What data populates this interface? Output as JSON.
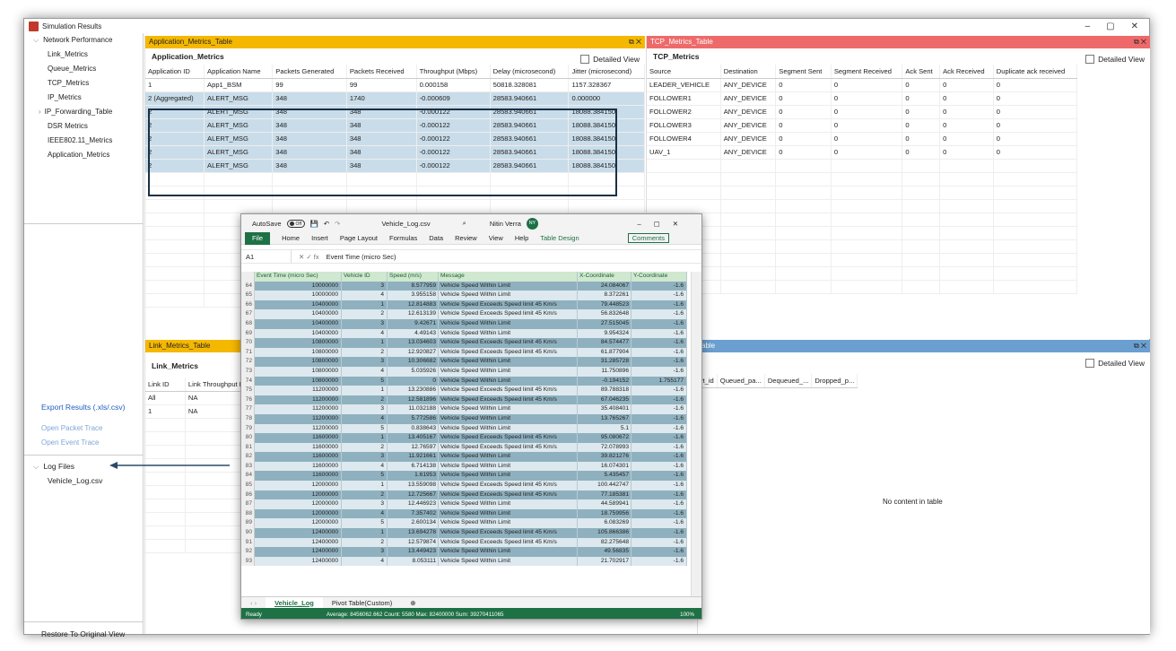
{
  "window": {
    "title": "Simulation Results",
    "controls": [
      "–",
      "▢",
      "✕"
    ]
  },
  "sidebar": {
    "tree_root": "Network Performance",
    "items": [
      "Link_Metrics",
      "Queue_Metrics",
      "TCP_Metrics",
      "IP_Metrics",
      "IP_Forwarding_Table",
      "DSR Metrics",
      "IEEE802.11_Metrics",
      "Application_Metrics"
    ],
    "export": "Export Results (.xls/.csv)",
    "open_packet": "Open Packet Trace",
    "open_event": "Open Event Trace",
    "log_root": "Log Files",
    "log_file": "Vehicle_Log.csv",
    "restore": "Restore To Original View"
  },
  "app_panel": {
    "header": "Application_Metrics_Table",
    "controls": "⧉ ✕",
    "title": "Application_Metrics",
    "detailed": "Detailed View",
    "columns": [
      "Application ID",
      "Application Name",
      "Packets Generated",
      "Packets Received",
      "Throughput (Mbps)",
      "Delay (microsecond)",
      "Jitter (microsecond)"
    ],
    "rows": [
      [
        "1",
        "App1_BSM",
        "99",
        "99",
        "0.000158",
        "50818.328081",
        "1157.328367"
      ],
      [
        "2 (Aggregated)",
        "ALERT_MSG",
        "348",
        "1740",
        "-0.000609",
        "28583.940661",
        "0.000000"
      ],
      [
        "2",
        "ALERT_MSG",
        "348",
        "348",
        "-0.000122",
        "28583.940661",
        "18088.384150"
      ],
      [
        "2",
        "ALERT_MSG",
        "348",
        "348",
        "-0.000122",
        "28583.940661",
        "18088.384150"
      ],
      [
        "2",
        "ALERT_MSG",
        "348",
        "348",
        "-0.000122",
        "28583.940661",
        "18088.384150"
      ],
      [
        "2",
        "ALERT_MSG",
        "348",
        "348",
        "-0.000122",
        "28583.940661",
        "18088.384150"
      ],
      [
        "2",
        "ALERT_MSG",
        "348",
        "348",
        "-0.000122",
        "28583.940661",
        "18088.384150"
      ]
    ]
  },
  "tcp_panel": {
    "header": "TCP_Metrics_Table",
    "controls": "⧉ ✕",
    "title": "TCP_Metrics",
    "detailed": "Detailed View",
    "columns": [
      "Source",
      "Destination",
      "Segment Sent",
      "Segment Received",
      "Ack Sent",
      "Ack Received",
      "Duplicate ack received"
    ],
    "rows": [
      [
        "LEADER_VEHICLE",
        "ANY_DEVICE",
        "0",
        "0",
        "0",
        "0",
        "0"
      ],
      [
        "FOLLOWER1",
        "ANY_DEVICE",
        "0",
        "0",
        "0",
        "0",
        "0"
      ],
      [
        "FOLLOWER2",
        "ANY_DEVICE",
        "0",
        "0",
        "0",
        "0",
        "0"
      ],
      [
        "FOLLOWER3",
        "ANY_DEVICE",
        "0",
        "0",
        "0",
        "0",
        "0"
      ],
      [
        "FOLLOWER4",
        "ANY_DEVICE",
        "0",
        "0",
        "0",
        "0",
        "0"
      ],
      [
        "UAV_1",
        "ANY_DEVICE",
        "0",
        "0",
        "0",
        "0",
        "0"
      ]
    ]
  },
  "link_panel": {
    "header": "Link_Metrics_Table",
    "title": "Link_Metrics",
    "columns": [
      "Link ID",
      "Link Throughput Pl"
    ],
    "rows": [
      [
        "All",
        "NA"
      ],
      [
        "1",
        "NA"
      ]
    ]
  },
  "queue_panel": {
    "header": "able",
    "controls": "⧉ ✕",
    "detailed": "Detailed View",
    "columns": [
      "rt_id",
      "Queued_pa...",
      "Dequeued_...",
      "Dropped_p..."
    ],
    "empty": "No content in table"
  },
  "excel": {
    "autosave": "AutoSave",
    "toggle": "Off",
    "filename": "Vehicle_Log.csv",
    "user": "Nitin Verra",
    "initials": "NY",
    "ribbon": [
      "File",
      "Home",
      "Insert",
      "Page Layout",
      "Formulas",
      "Data",
      "Review",
      "View",
      "Help",
      "Table Design"
    ],
    "comments": "Comments",
    "cell_ref": "A1",
    "formula": "Event Time (micro Sec)",
    "headers": [
      "Event Time (micro Sec)",
      "Vehicle ID",
      "Speed (m/s)",
      "Message",
      "X-Coordinate",
      "Y-Coordinate"
    ],
    "rows": [
      [
        "64",
        "10000000",
        "3",
        "8.577959",
        "Vehicle Speed Within Limit",
        "24.084067",
        "-1.6"
      ],
      [
        "65",
        "10000000",
        "4",
        "3.955158",
        "Vehicle Speed Within Limit",
        "8.372261",
        "-1.6"
      ],
      [
        "66",
        "10400000",
        "1",
        "12.814883",
        "Vehicle Speed Exceeds Speed limit 45 Km/s",
        "79.448523",
        "-1.6"
      ],
      [
        "67",
        "10400000",
        "2",
        "12.613139",
        "Vehicle Speed Exceeds Speed limit 45 Km/s",
        "56.832648",
        "-1.6"
      ],
      [
        "68",
        "10400000",
        "3",
        "9.42671",
        "Vehicle Speed Within Limit",
        "27.515045",
        "-1.6"
      ],
      [
        "69",
        "10400000",
        "4",
        "4.49143",
        "Vehicle Speed Within Limit",
        "9.954324",
        "-1.6"
      ],
      [
        "70",
        "10800000",
        "1",
        "13.034603",
        "Vehicle Speed Exceeds Speed limit 45 Km/s",
        "84.574477",
        "-1.6"
      ],
      [
        "71",
        "10800000",
        "2",
        "12.920827",
        "Vehicle Speed Exceeds Speed limit 45 Km/s",
        "61.877904",
        "-1.6"
      ],
      [
        "72",
        "10800000",
        "3",
        "10.306682",
        "Vehicle Speed Within Limit",
        "31.285728",
        "-1.6"
      ],
      [
        "73",
        "10800000",
        "4",
        "5.035926",
        "Vehicle Speed Within Limit",
        "11.750896",
        "-1.6"
      ],
      [
        "74",
        "10800000",
        "5",
        "0",
        "Vehicle Speed Within Limit",
        "-0.194152",
        "1.755177"
      ],
      [
        "75",
        "11200000",
        "1",
        "13.230886",
        "Vehicle Speed Exceeds Speed limit 45 Km/s",
        "89.788318",
        "-1.6"
      ],
      [
        "76",
        "11200000",
        "2",
        "12.581896",
        "Vehicle Speed Exceeds Speed limit 45 Km/s",
        "67.046235",
        "-1.6"
      ],
      [
        "77",
        "11200000",
        "3",
        "11.032188",
        "Vehicle Speed Within Limit",
        "35.408401",
        "-1.6"
      ],
      [
        "78",
        "11200000",
        "4",
        "5.772586",
        "Vehicle Speed Within Limit",
        "13.765267",
        "-1.6"
      ],
      [
        "79",
        "11200000",
        "5",
        "0.838643",
        "Vehicle Speed Within Limit",
        "5.1",
        "-1.6"
      ],
      [
        "80",
        "11600000",
        "1",
        "13.405167",
        "Vehicle Speed Exceeds Speed limit 45 Km/s",
        "95.080672",
        "-1.6"
      ],
      [
        "81",
        "11600000",
        "2",
        "12.76597",
        "Vehicle Speed Exceeds Speed limit 45 Km/s",
        "72.078993",
        "-1.6"
      ],
      [
        "82",
        "11600000",
        "3",
        "11.921661",
        "Vehicle Speed Within Limit",
        "39.821276",
        "-1.6"
      ],
      [
        "83",
        "11600000",
        "4",
        "6.714138",
        "Vehicle Speed Within Limit",
        "16.074301",
        "-1.6"
      ],
      [
        "84",
        "11600000",
        "5",
        "1.61953",
        "Vehicle Speed Within Limit",
        "5.435457",
        "-1.6"
      ],
      [
        "85",
        "12000000",
        "1",
        "13.559098",
        "Vehicle Speed Exceeds Speed limit 45 Km/s",
        "100.442747",
        "-1.6"
      ],
      [
        "86",
        "12000000",
        "2",
        "12.725667",
        "Vehicle Speed Exceeds Speed limit 45 Km/s",
        "77.185381",
        "-1.6"
      ],
      [
        "87",
        "12000000",
        "3",
        "12.446923",
        "Vehicle Speed Within Limit",
        "44.589941",
        "-1.6"
      ],
      [
        "88",
        "12000000",
        "4",
        "7.357402",
        "Vehicle Speed Within Limit",
        "18.759956",
        "-1.6"
      ],
      [
        "89",
        "12000000",
        "5",
        "2.600134",
        "Vehicle Speed Within Limit",
        "6.083269",
        "-1.6"
      ],
      [
        "90",
        "12400000",
        "1",
        "13.694278",
        "Vehicle Speed Exceeds Speed limit 45 Km/s",
        "105.866386",
        "-1.6"
      ],
      [
        "91",
        "12400000",
        "2",
        "12.579874",
        "Vehicle Speed Exceeds Speed limit 45 Km/s",
        "82.275648",
        "-1.6"
      ],
      [
        "92",
        "12400000",
        "3",
        "13.449423",
        "Vehicle Speed Within Limit",
        "49.56835",
        "-1.6"
      ],
      [
        "93",
        "12400000",
        "4",
        "8.053111",
        "Vehicle Speed Within Limit",
        "21.702917",
        "-1.6"
      ]
    ],
    "tabs": [
      "Vehicle_Log",
      "Pivot Table(Custom)"
    ],
    "status": {
      "ready": "Ready",
      "summary": "Average: 8456062.662   Count: 5580   Max: 82400000   Sum: 39270411065",
      "zoom": "100%"
    }
  }
}
